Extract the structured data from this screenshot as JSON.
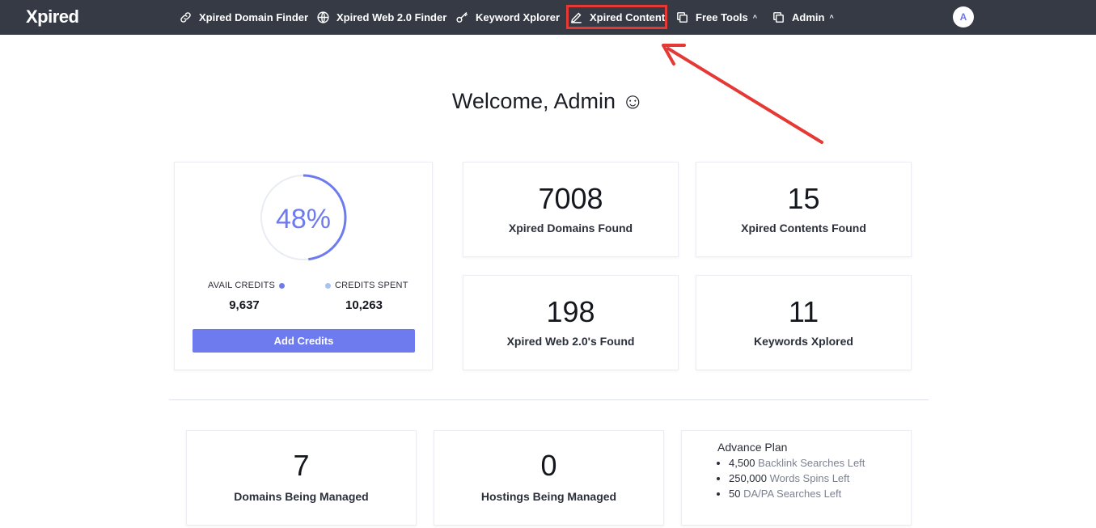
{
  "app": {
    "logo": "Xpired"
  },
  "nav": {
    "items": [
      {
        "label": "Xpired Domain Finder",
        "icon": "link-icon"
      },
      {
        "label": "Xpired Web 2.0 Finder",
        "icon": "globe-icon"
      },
      {
        "label": "Keyword Xplorer",
        "icon": "key-icon"
      },
      {
        "label": "Xpired Content",
        "icon": "pen-icon",
        "highlighted": true
      },
      {
        "label": "Free Tools",
        "icon": "copy-icon",
        "dropdown": true
      },
      {
        "label": "Admin",
        "icon": "copy-icon",
        "dropdown": true
      }
    ],
    "caret": "^",
    "avatar": "A"
  },
  "welcome": "Welcome, Admin ☺",
  "credits": {
    "percent_label": "48%",
    "percent_value": 48,
    "avail_label": "AVAIL CREDITS",
    "avail_value": "9,637",
    "spent_label": "CREDITS SPENT",
    "spent_value": "10,263",
    "add_button": "Add Credits"
  },
  "stats": [
    {
      "value": "7008",
      "label": "Xpired Domains Found"
    },
    {
      "value": "15",
      "label": "Xpired Contents Found"
    },
    {
      "value": "198",
      "label": "Xpired Web 2.0's Found"
    },
    {
      "value": "11",
      "label": "Keywords Xplored"
    }
  ],
  "managed": [
    {
      "value": "7",
      "label": "Domains Being Managed"
    },
    {
      "value": "0",
      "label": "Hostings Being Managed"
    }
  ],
  "plan": {
    "title": "Advance Plan",
    "items": [
      {
        "value": "4,500",
        "text": "Backlink Searches Left"
      },
      {
        "value": "250,000",
        "text": "Words Spins Left"
      },
      {
        "value": "50",
        "text": "DA/PA Searches Left"
      }
    ]
  },
  "colors": {
    "topbar": "#353a45",
    "accent": "#6e7bef",
    "ring_light": "#e9ecf3",
    "avail_dot": "#6e7bef",
    "spent_dot": "#a9c2f0",
    "annotation": "#e53935"
  }
}
